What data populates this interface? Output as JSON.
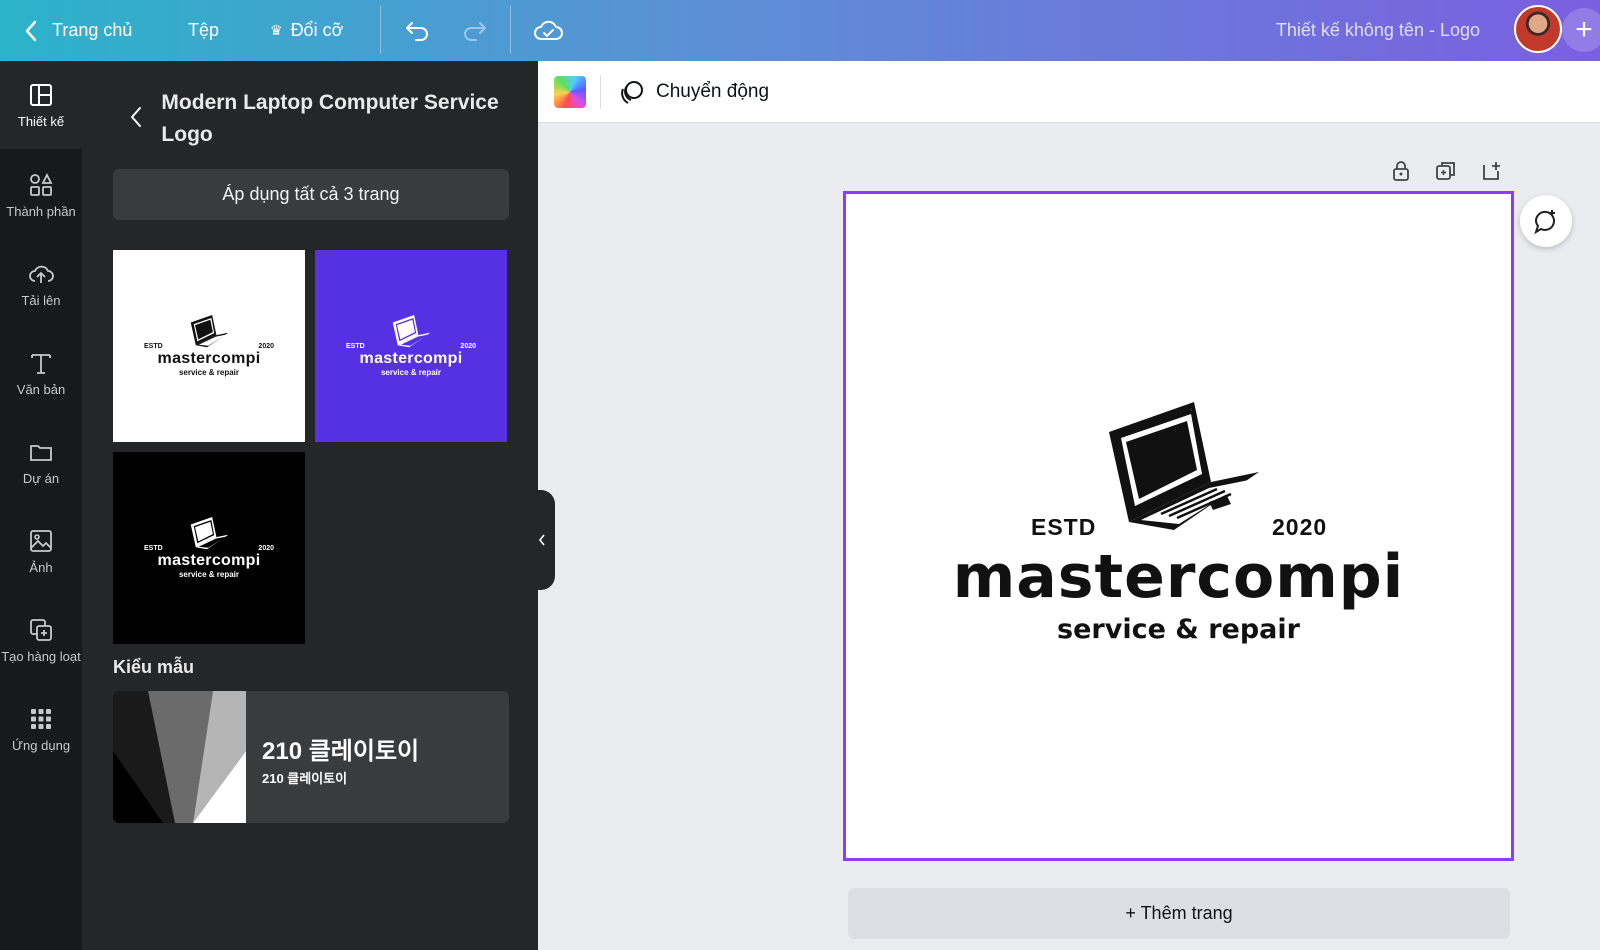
{
  "topbar": {
    "home_label": "Trang chủ",
    "file_label": "Tệp",
    "resize_label": "Đổi cỡ",
    "doc_title": "Thiết kế không tên - Logo",
    "plus_label": "+"
  },
  "rail": {
    "items": [
      {
        "label": "Thiết kế",
        "icon": "layout-icon"
      },
      {
        "label": "Thành phần",
        "icon": "shapes-icon"
      },
      {
        "label": "Tải lên",
        "icon": "cloud-upload-icon"
      },
      {
        "label": "Văn bản",
        "icon": "text-icon"
      },
      {
        "label": "Dự án",
        "icon": "folder-icon"
      },
      {
        "label": "Ảnh",
        "icon": "image-icon"
      },
      {
        "label": "Tạo hàng loạt",
        "icon": "bulk-create-icon"
      },
      {
        "label": "Ứng dụng",
        "icon": "apps-grid-icon"
      }
    ]
  },
  "panel": {
    "title": "Modern Laptop Computer Service Logo",
    "apply_all_label": "Áp dụng tất cả 3 trang",
    "thumbnails": [
      {
        "bg": "#ffffff",
        "fg": "#111111"
      },
      {
        "bg": "#5531e3",
        "fg": "#ffffff"
      },
      {
        "bg": "#000000",
        "fg": "#ffffff"
      }
    ],
    "styles_heading": "Kiểu mẫu",
    "font_card": {
      "title": "210 클레이토이",
      "subtitle": "210 클레이토이"
    }
  },
  "editor": {
    "animate_label": "Chuyển động"
  },
  "logo": {
    "estd": "ESTD",
    "year": "2020",
    "name": "mastercompi",
    "tagline": "service & repair"
  },
  "add_page_label": "+ Thêm trang",
  "colors": {
    "accent": "#8b3dff",
    "panel_bg": "#252627",
    "rail_bg": "#18191b"
  }
}
